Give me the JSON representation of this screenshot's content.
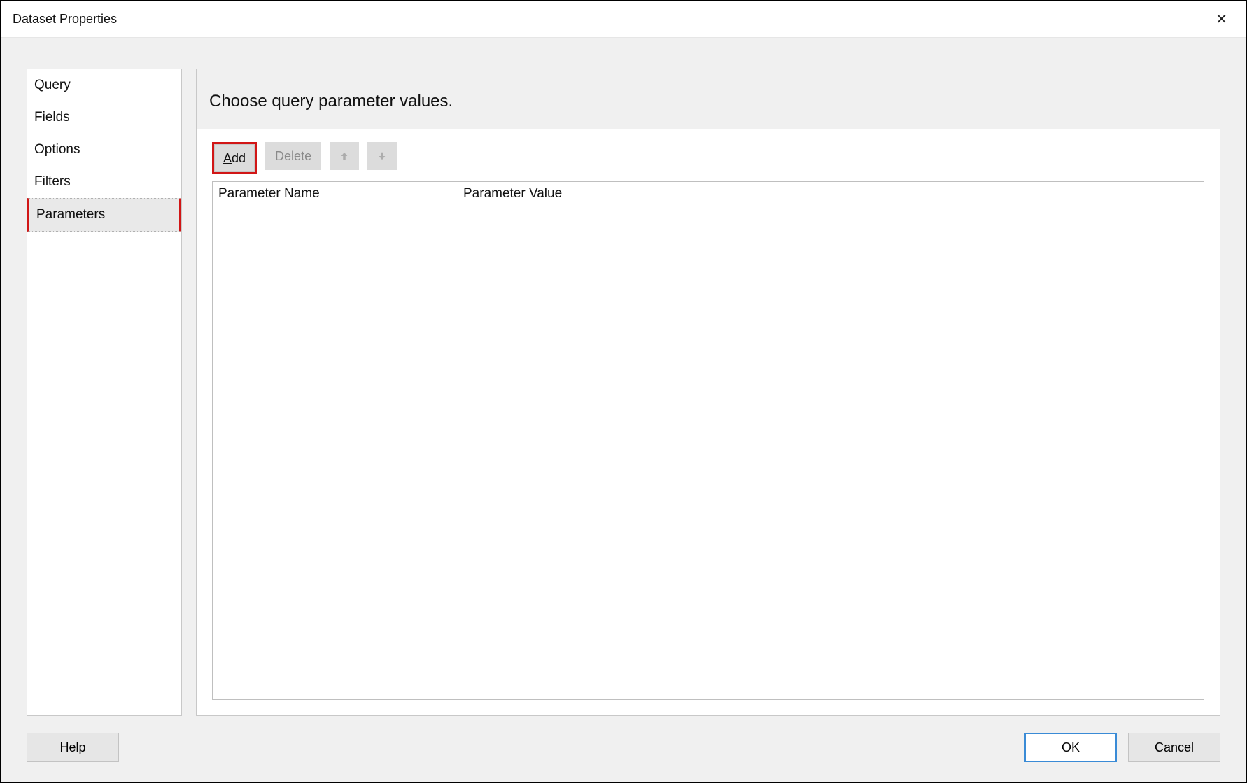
{
  "dialog": {
    "title": "Dataset Properties"
  },
  "sidebar": {
    "items": [
      {
        "label": "Query",
        "selected": false
      },
      {
        "label": "Fields",
        "selected": false
      },
      {
        "label": "Options",
        "selected": false
      },
      {
        "label": "Filters",
        "selected": false
      },
      {
        "label": "Parameters",
        "selected": true,
        "highlighted": true
      }
    ]
  },
  "main": {
    "heading": "Choose query parameter values.",
    "toolbar": {
      "add_label": "Add",
      "add_highlighted": true,
      "delete_label": "Delete",
      "move_up_label": "Move Up",
      "move_down_label": "Move Down"
    },
    "grid": {
      "columns": [
        "Parameter Name",
        "Parameter Value"
      ],
      "rows": []
    }
  },
  "footer": {
    "help_label": "Help",
    "ok_label": "OK",
    "cancel_label": "Cancel"
  }
}
